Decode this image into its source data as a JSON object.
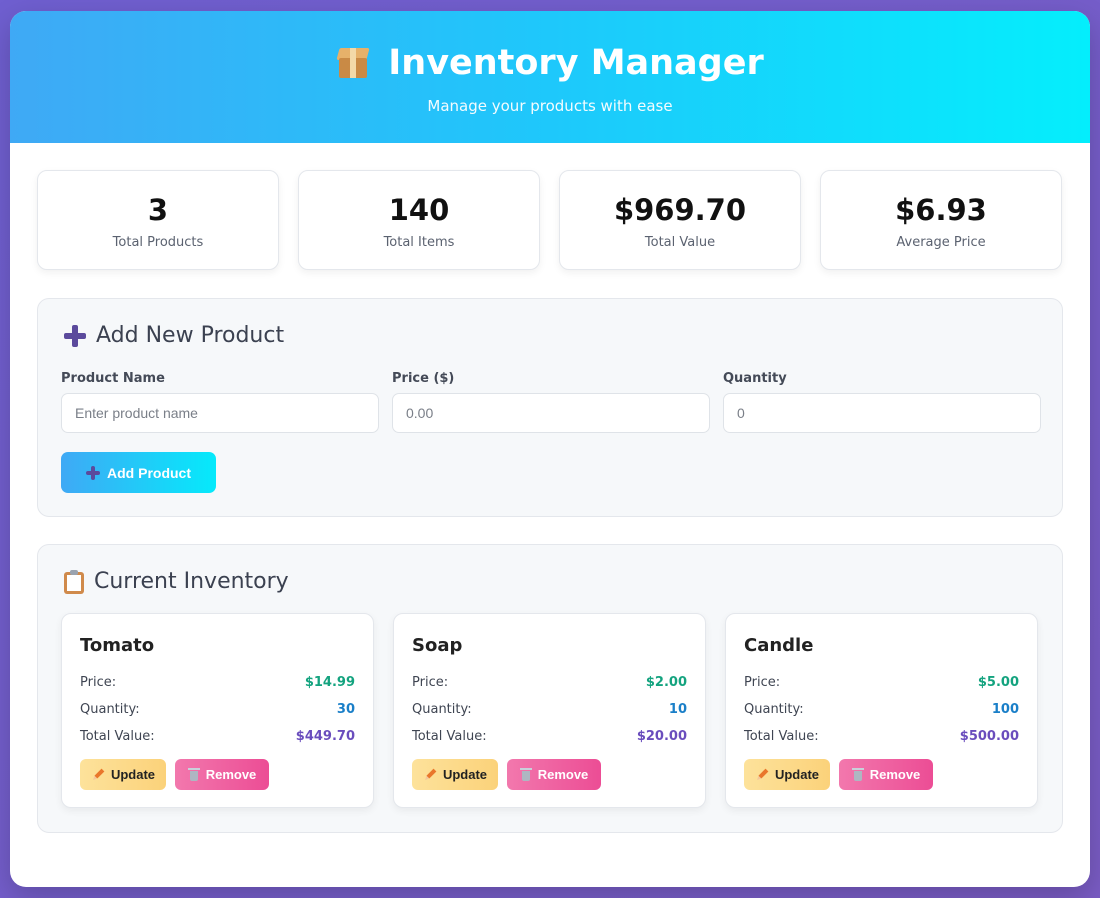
{
  "header": {
    "title": "Inventory Manager",
    "subtitle": "Manage your products with ease",
    "icon": "package-icon"
  },
  "stats": [
    {
      "value": "3",
      "label": "Total Products"
    },
    {
      "value": "140",
      "label": "Total Items"
    },
    {
      "value": "$969.70",
      "label": "Total Value"
    },
    {
      "value": "$6.93",
      "label": "Average Price"
    }
  ],
  "add_form": {
    "title": "Add New Product",
    "icon": "plus-icon",
    "fields": [
      {
        "label": "Product Name",
        "placeholder": "Enter product name"
      },
      {
        "label": "Price ($)",
        "placeholder": "0.00"
      },
      {
        "label": "Quantity",
        "placeholder": "0"
      }
    ],
    "submit_label": "Add Product"
  },
  "inventory": {
    "title": "Current Inventory",
    "icon": "clipboard-icon",
    "row_labels": {
      "price": "Price:",
      "quantity": "Quantity:",
      "total": "Total Value:"
    },
    "update_label": "Update",
    "remove_label": "Remove",
    "items": [
      {
        "name": "Tomato",
        "price": "$14.99",
        "quantity": "30",
        "total": "$449.70"
      },
      {
        "name": "Soap",
        "price": "$2.00",
        "quantity": "10",
        "total": "$20.00"
      },
      {
        "name": "Candle",
        "price": "$5.00",
        "quantity": "100",
        "total": "$500.00"
      }
    ]
  },
  "colors": {
    "header_gradient_start": "#3fa9f5",
    "header_gradient_end": "#04eefc",
    "price": "#14a37f",
    "quantity": "#1a7fc8",
    "total": "#6a4dbd",
    "update_button": "#fbd27a",
    "remove_button": "#ec4d95"
  }
}
